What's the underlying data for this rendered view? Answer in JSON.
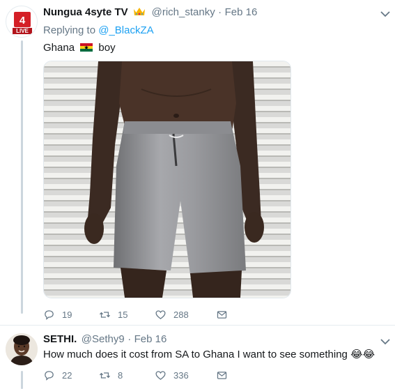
{
  "tweet1": {
    "display_name": "Nungua 4syte TV",
    "verified_emoji": "crown-emoji",
    "handle": "@rich_stanky",
    "separator": "·",
    "date": "Feb 16",
    "reply_prefix": "Replying to",
    "reply_to": "@_BlackZA",
    "text_before_flag": "Ghana",
    "text_after_flag": "boy",
    "avatar_badge_text": "LIVE",
    "replies": "19",
    "retweets": "15",
    "likes": "288"
  },
  "tweet2": {
    "display_name": "SETHI.",
    "handle": "@Sethy9",
    "separator": "·",
    "date": "Feb 16",
    "text": "How much does it cost from SA to Ghana I want to see something",
    "emoji": "😂😂",
    "replies": "22",
    "retweets": "8",
    "likes": "336"
  },
  "colors": {
    "accent": "#1da1f2",
    "muted": "#657786",
    "thread": "#ccd6dd",
    "flag_red": "#ce1126",
    "flag_yellow": "#fcd116",
    "flag_green": "#006b3f"
  }
}
